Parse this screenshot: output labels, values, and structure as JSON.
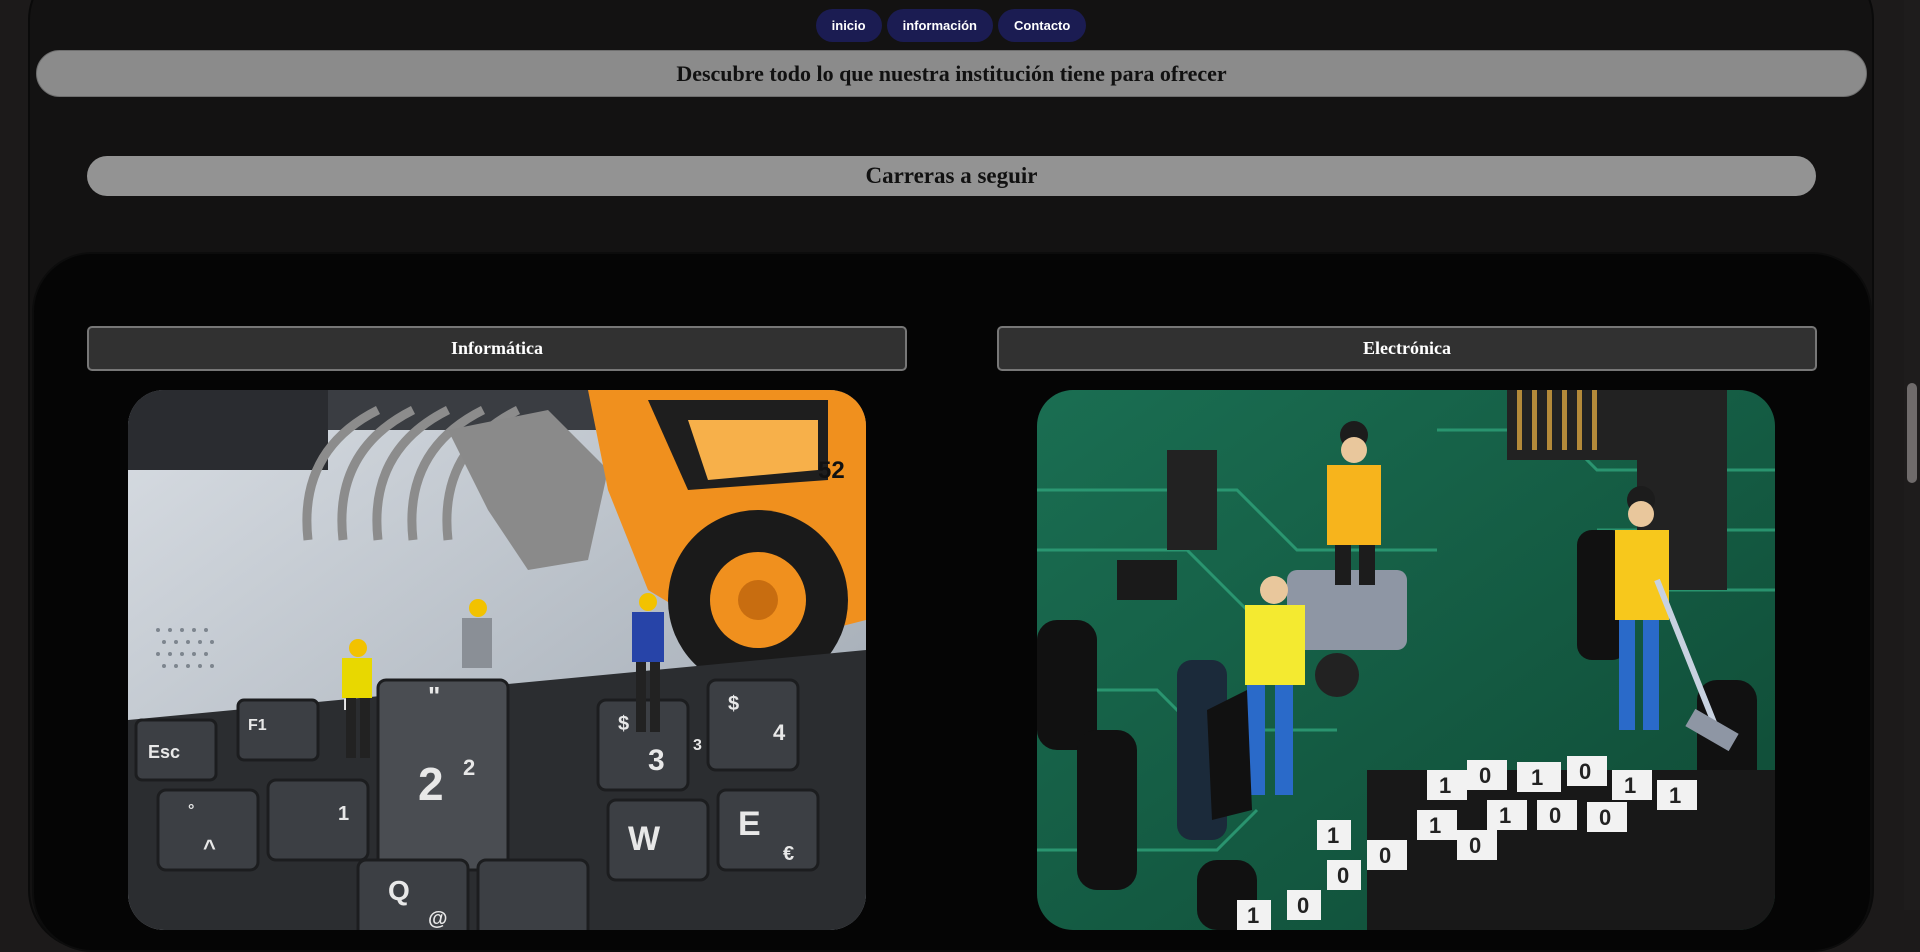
{
  "nav": {
    "items": [
      {
        "label": "inicio"
      },
      {
        "label": "información"
      },
      {
        "label": "Contacto"
      }
    ]
  },
  "banner": {
    "text": "Descubre todo lo que nuestra institución tiene para ofrecer"
  },
  "section": {
    "title": "Carreras a seguir"
  },
  "cards": [
    {
      "title": "Informática",
      "image": "miniature-workers-on-laptop-keyboard-photo"
    },
    {
      "title": "Electrónica",
      "image": "miniature-workers-on-circuit-board-photo"
    }
  ],
  "informatica_keys": [
    "Esc",
    "F1",
    "F",
    "\"",
    "$",
    "$",
    "2",
    "2",
    "1",
    "3",
    "3",
    "4",
    "°",
    "^",
    "Q",
    "@",
    "W",
    "E",
    "€",
    "52"
  ],
  "electronica_digits": [
    "1",
    "0",
    "1",
    "0",
    "1",
    "1",
    "1",
    "0",
    "0",
    "1",
    "0",
    "0",
    "1",
    "0",
    "0",
    "1"
  ],
  "colors": {
    "nav_bg": "#1b1c52",
    "banner_bg": "#8b8b8b",
    "section_bg": "#939393",
    "card_title_bg": "#313131",
    "page_bg": "#131212",
    "panel_bg": "#050505"
  }
}
